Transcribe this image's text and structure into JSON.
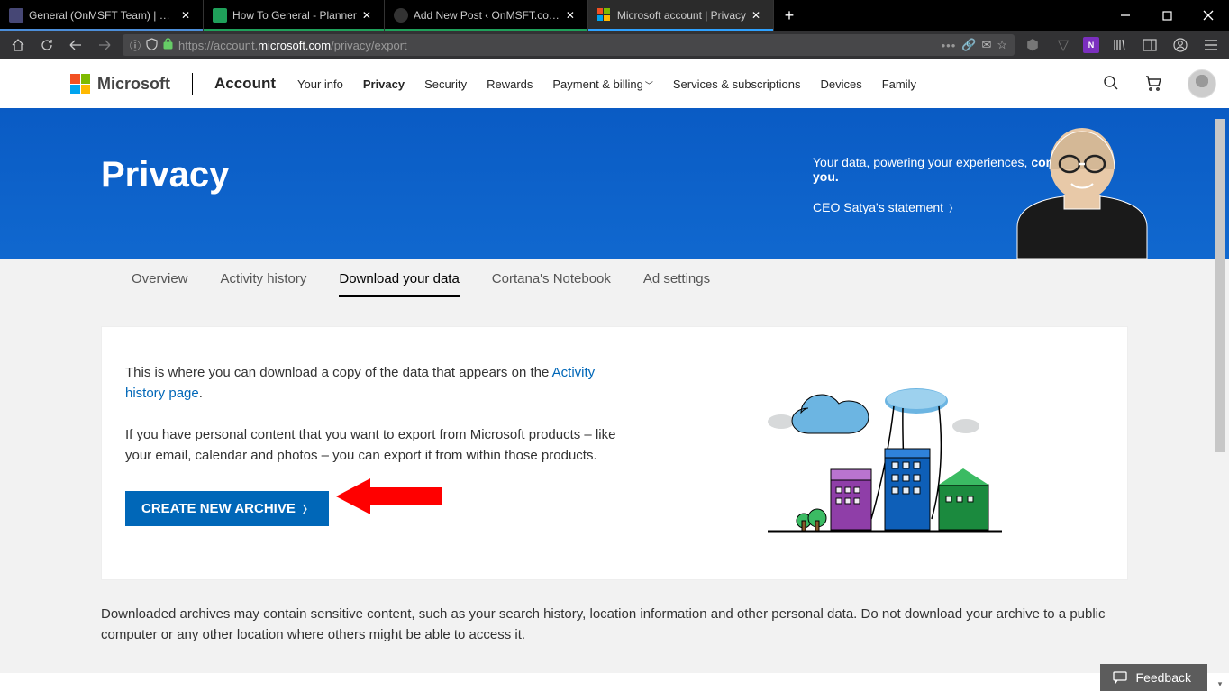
{
  "browser": {
    "tabs": [
      {
        "label": "General (OnMSFT Team) | Micro",
        "accent": "#4c8ed9"
      },
      {
        "label": "How To General - Planner",
        "accent": "#1fa05a"
      },
      {
        "label": "Add New Post ‹ OnMSFT.com — W",
        "accent": "#1fa05a"
      },
      {
        "label": "Microsoft account | Privacy",
        "accent": "#2fa2ff",
        "active": true
      }
    ],
    "url_prefix": "https://",
    "url_host": "account.",
    "url_bold": "microsoft.com",
    "url_path": "/privacy/export"
  },
  "header": {
    "brand": "Microsoft",
    "account": "Account",
    "nav": [
      "Your info",
      "Privacy",
      "Security",
      "Rewards",
      "Payment & billing",
      "Services & subscriptions",
      "Devices",
      "Family"
    ],
    "nav_active": "Privacy",
    "nav_dropdown": "Payment & billing"
  },
  "hero": {
    "title": "Privacy",
    "tagline_pre": "Your data, powering your experiences, ",
    "tagline_bold": "controlled by you.",
    "statement": "CEO Satya's statement"
  },
  "subtabs": [
    "Overview",
    "Activity history",
    "Download your data",
    "Cortana's Notebook",
    "Ad settings"
  ],
  "subtab_active": "Download your data",
  "card": {
    "intro_pre": "This is where you can download a copy of the data that appears on the ",
    "intro_link": "Activity history page",
    "intro_post": ".",
    "para2": "If you have personal content that you want to export from Microsoft products – like your email, calendar and photos – you can export it from within those products.",
    "cta": "CREATE NEW ARCHIVE"
  },
  "notice": "Downloaded archives may contain sensitive content, such as your search history, location information and other personal data. Do not download your archive to a public computer or any other location where others might be able to access it.",
  "feedback": "Feedback"
}
